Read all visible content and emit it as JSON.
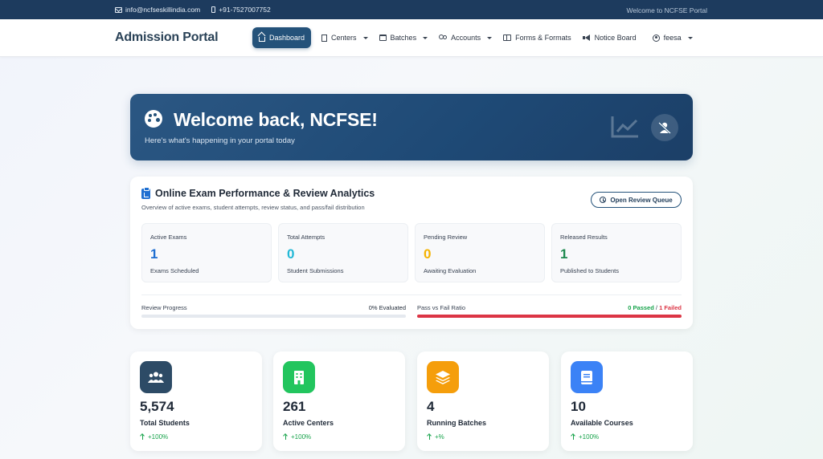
{
  "topbar": {
    "email": "info@ncfseskillindia.com",
    "phone": "+91-7527007752",
    "welcome": "Welcome to NCFSE Portal"
  },
  "navbar": {
    "brand": "Admission Portal",
    "items": [
      {
        "label": "Dashboard",
        "icon": "home-icon",
        "active": true
      },
      {
        "label": "Centers",
        "icon": "building-icon",
        "dropdown": true
      },
      {
        "label": "Batches",
        "icon": "calendar-icon",
        "dropdown": true
      },
      {
        "label": "Accounts",
        "icon": "users-icon",
        "dropdown": true
      },
      {
        "label": "Forms & Formats",
        "icon": "book-icon"
      },
      {
        "label": "Notice Board",
        "icon": "megaphone-icon"
      },
      {
        "label": "feesa",
        "icon": "user-icon",
        "dropdown": true
      }
    ]
  },
  "banner": {
    "title": "Welcome back, NCFSE!",
    "subtitle": "Here's what's happening in your portal today"
  },
  "analytics": {
    "title": "Online Exam Performance & Review Analytics",
    "subtitle": "Overview of active exams, student attempts, review status, and pass/fail distribution",
    "review_button": "Open Review Queue",
    "stats": [
      {
        "label": "Active Exams",
        "value": "1",
        "sub": "Exams Scheduled",
        "color": "#1f6fd1"
      },
      {
        "label": "Total Attempts",
        "value": "0",
        "sub": "Student Submissions",
        "color": "#22b8d6"
      },
      {
        "label": "Pending Review",
        "value": "0",
        "sub": "Awaiting Evaluation",
        "color": "#f5b301"
      },
      {
        "label": "Released Results",
        "value": "1",
        "sub": "Published to Students",
        "color": "#1e8a4f"
      }
    ],
    "review_progress": {
      "label": "Review Progress",
      "value_text": "0% Evaluated",
      "percent": 0
    },
    "pass_fail": {
      "label": "Pass vs Fail Ratio",
      "passed_text": "0 Passed",
      "separator": " / ",
      "failed_text": "1 Failed",
      "passed": 0,
      "failed": 1,
      "pass_color": "#16a34a",
      "fail_color": "#dc3545"
    }
  },
  "cards": [
    {
      "value": "5,574",
      "label": "Total Students",
      "trend": "+100%",
      "icon": "users-group-icon",
      "color": "#2d4b66"
    },
    {
      "value": "261",
      "label": "Active Centers",
      "trend": "+100%",
      "icon": "building-icon",
      "color": "#22c55e"
    },
    {
      "value": "4",
      "label": "Running Batches",
      "trend": "+%",
      "icon": "layers-icon",
      "color": "#f59e0b"
    },
    {
      "value": "10",
      "label": "Available Courses",
      "trend": "+100%",
      "icon": "book-icon",
      "color": "#3b82f6"
    }
  ]
}
